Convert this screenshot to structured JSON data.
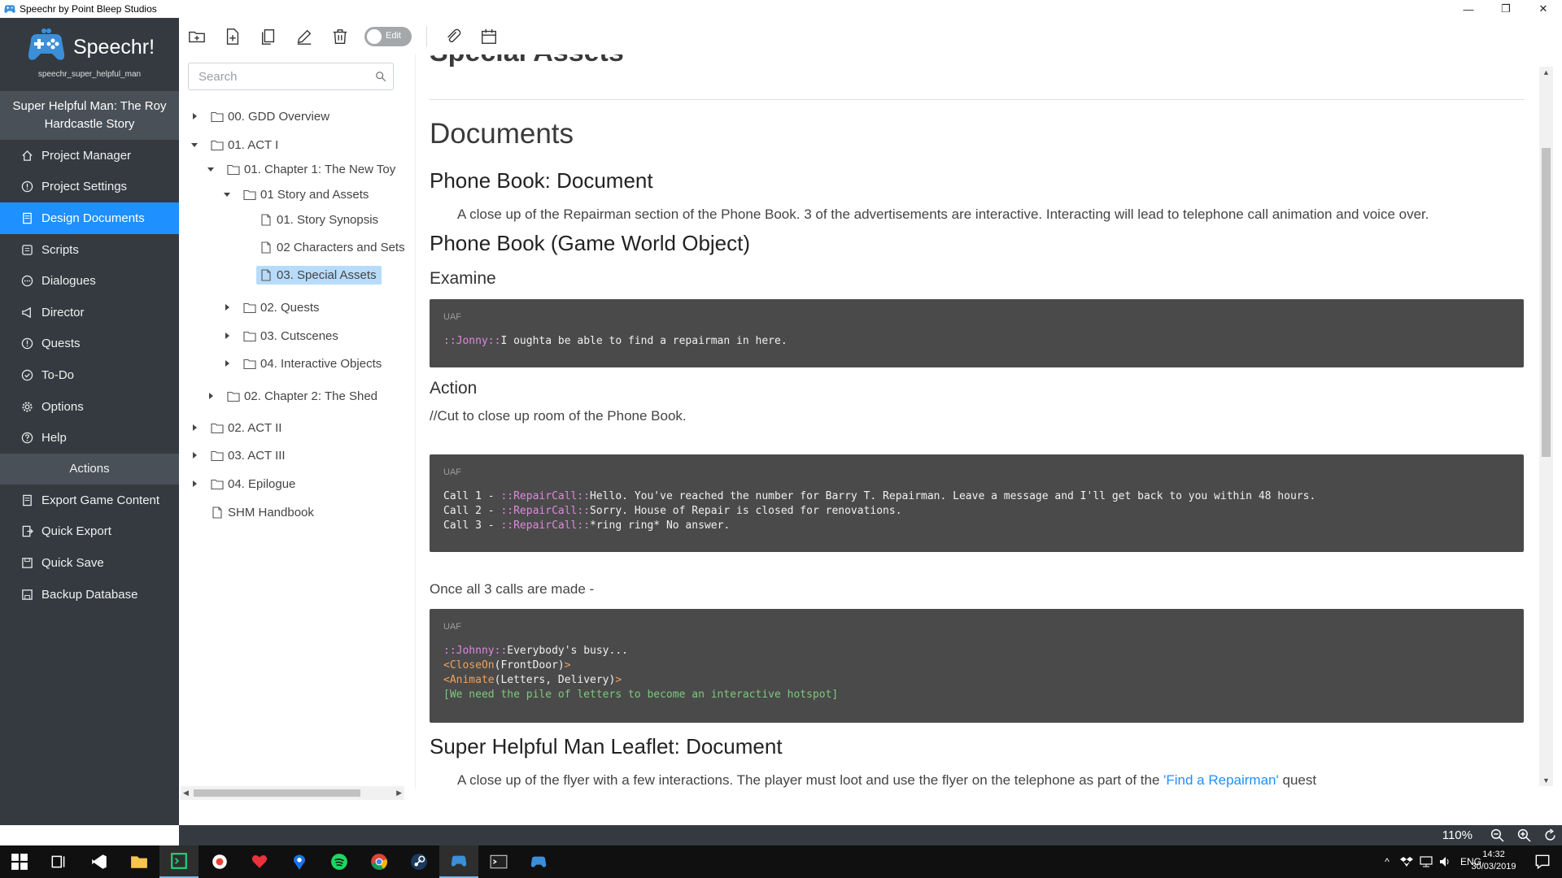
{
  "window": {
    "title": "Speechr by Point Bleep Studios",
    "controls": [
      "—",
      "❐",
      "✕"
    ]
  },
  "sidebar": {
    "brand": "Speechr!",
    "username": "speechr_super_helpful_man",
    "project_title": "Super Helpful Man: The Roy Hardcastle Story",
    "nav": [
      {
        "label": "Project Manager",
        "icon": "home-icon"
      },
      {
        "label": "Project Settings",
        "icon": "info-icon"
      },
      {
        "label": "Design Documents",
        "icon": "document-icon",
        "active": true
      },
      {
        "label": "Scripts",
        "icon": "script-icon"
      },
      {
        "label": "Dialogues",
        "icon": "chat-icon"
      },
      {
        "label": "Director",
        "icon": "megaphone-icon"
      },
      {
        "label": "Quests",
        "icon": "alert-icon"
      },
      {
        "label": "To-Do",
        "icon": "check-icon"
      },
      {
        "label": "Options",
        "icon": "gear-icon"
      },
      {
        "label": "Help",
        "icon": "help-icon"
      }
    ],
    "actions_header": "Actions",
    "actions": [
      {
        "label": "Export Game Content",
        "icon": "export-icon"
      },
      {
        "label": "Quick Export",
        "icon": "quick-export-icon"
      },
      {
        "label": "Quick Save",
        "icon": "save-icon"
      },
      {
        "label": "Backup Database",
        "icon": "database-icon"
      }
    ]
  },
  "toolbar": {
    "edit_toggle_label": "Edit",
    "buttons": [
      "new-folder-icon",
      "new-file-icon",
      "duplicate-icon",
      "pencil-icon",
      "trash-icon",
      "paperclip-icon",
      "calendar-icon"
    ]
  },
  "tree": {
    "search_placeholder": "Search",
    "items": [
      {
        "label": "00. GDD Overview",
        "type": "folder",
        "level": 0,
        "expanded": false
      },
      {
        "label": "01. ACT I",
        "type": "folder",
        "level": 0,
        "expanded": true
      },
      {
        "label": "01. Chapter 1: The New Toy",
        "type": "folder",
        "level": 1,
        "expanded": true
      },
      {
        "label": "01 Story and Assets",
        "type": "folder",
        "level": 2,
        "expanded": true
      },
      {
        "label": "01. Story Synopsis",
        "type": "file",
        "level": 3
      },
      {
        "label": "02 Characters and Sets",
        "type": "file",
        "level": 3
      },
      {
        "label": "03. Special Assets",
        "type": "file",
        "level": 3,
        "selected": true
      },
      {
        "label": "02. Quests",
        "type": "folder",
        "level": 2,
        "expanded": false
      },
      {
        "label": "03. Cutscenes",
        "type": "folder",
        "level": 2,
        "expanded": false
      },
      {
        "label": "04. Interactive Objects",
        "type": "folder",
        "level": 2,
        "expanded": false
      },
      {
        "label": "02. Chapter 2: The Shed",
        "type": "folder",
        "level": 1,
        "expanded": false
      },
      {
        "label": "02. ACT II",
        "type": "folder",
        "level": 0,
        "expanded": false
      },
      {
        "label": "03. ACT III",
        "type": "folder",
        "level": 0,
        "expanded": false
      },
      {
        "label": "04. Epilogue",
        "type": "folder",
        "level": 0,
        "expanded": false
      },
      {
        "label": "SHM Handbook",
        "type": "file",
        "level": 0
      }
    ]
  },
  "document": {
    "cut_heading": "Special Assets",
    "section_title": "Documents",
    "phone_book_title": "Phone Book: Document",
    "phone_book_desc": "A close up of the Repairman section of the Phone Book. 3 of the advertisements are interactive. Interacting will lead to telephone call animation and voice over.",
    "phone_book_object_title": "Phone Book (Game World Object)",
    "examine_heading": "Examine",
    "code1": {
      "lang": "UAF",
      "speaker": "::Jonny::",
      "text": "I oughta be able to find a repairman in here."
    },
    "action_heading": "Action",
    "action_text": "//Cut to close up room of the Phone Book.",
    "code2": {
      "lang": "UAF",
      "lines": [
        {
          "prefix": "Call 1 - ",
          "speaker": "::RepairCall::",
          "text": "Hello. You've reached the number for Barry T. Repairman. Leave a message and I'll get back to you within 48 hours."
        },
        {
          "prefix": "Call 2 - ",
          "speaker": "::RepairCall::",
          "text": "Sorry. House of Repair is closed for renovations."
        },
        {
          "prefix": "Call 3 - ",
          "speaker": "::RepairCall::",
          "text": "*ring ring* No answer."
        }
      ]
    },
    "calls_text": "Once all 3 calls are made -",
    "code3": {
      "lang": "UAF",
      "speaker": "::Johnny::",
      "speaker_text": "Everybody's busy...",
      "cmd1_name": "<CloseOn",
      "cmd1_args": "(FrontDoor)",
      "cmd1_end": ">",
      "cmd2_name": "<Animate",
      "cmd2_args": "(Letters, Delivery)",
      "cmd2_end": ">",
      "note": "[We need the pile of letters to become an interactive hotspot]"
    },
    "leaflet_title": "Super Helpful Man Leaflet: Document",
    "leaflet_desc_before": "A close up of the flyer with a few interactions. The player must loot and use the flyer on the telephone as part of the ",
    "leaflet_link": "'Find a Repairman'",
    "leaflet_desc_after": " quest"
  },
  "statusbar": {
    "zoom": "110%"
  },
  "taskbar": {
    "language": "ENG",
    "time": "14:32",
    "date": "30/03/2019"
  },
  "colors": {
    "sidebar_bg": "#343a40",
    "sidebar_active": "#1e90ff",
    "code_bg": "#4a4a4a",
    "selected_tree": "#b7dcfb",
    "link": "#1e90ff"
  }
}
